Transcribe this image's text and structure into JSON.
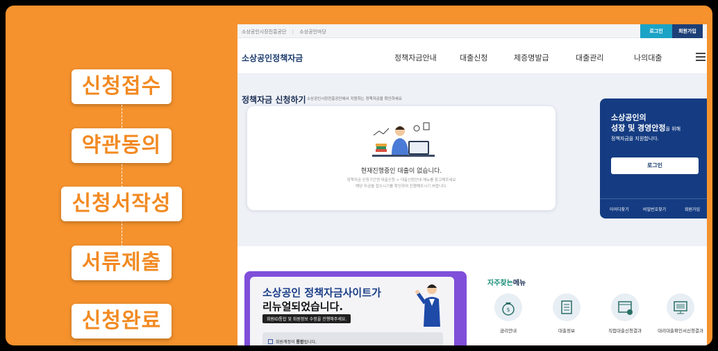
{
  "steps": [
    "신청접수",
    "약관동의",
    "신청서작성",
    "서류제출",
    "신청완료"
  ],
  "site": {
    "top_links": [
      "소상공인시장진흥공단",
      "소상공인마당"
    ],
    "login_label": "로그인",
    "join_label": "회원가입",
    "logo": "소상공인정책자금",
    "menu": [
      "정책자금안내",
      "대출신청",
      "제증명발급",
      "대출관리",
      "나의대출"
    ]
  },
  "apply": {
    "title": "정책자금 신청하기",
    "subtitle": "소상공인시장진흥공단에서 지원하는 정책자금을 확인하세요",
    "empty_message": "현재진행중인 대출이 없습니다.",
    "desc_line1": "정책자금 신청기간엔 대출신청 > 대출신청안내 메뉴를 참고해주세요",
    "desc_line2": "해당 자금별 접수시기를 확인하여 진행해주시기 바랍니다."
  },
  "panel": {
    "line1": "소상공인의",
    "line2_bold": "성장 및 경영안정",
    "line2_rest": "을 위해",
    "line3": "정책자금을 지원합니다.",
    "login_button": "로그인",
    "links": [
      "아이디찾기",
      "비밀번호찾기",
      "회원가입"
    ]
  },
  "banner": {
    "line1": "소상공인 정책자금사이트가",
    "line2": "리뉴얼되었습니다.",
    "pill": "회원ID통합 및 회원정보 수정을 진행해주세요.",
    "notice_prefix": "회원계정이 ",
    "notice_bold": "통합",
    "notice_suffix": "됩니다."
  },
  "favorites": {
    "title_accent": "자주찾는",
    "title_rest": "메뉴",
    "items": [
      "금리안내",
      "대출정보",
      "직접대출신청결과",
      "대리대출확인서신청결과"
    ]
  },
  "colors": {
    "background_orange": "#f5922d",
    "step_text": "#f28a22",
    "navy": "#153c82",
    "teal_button": "#1aa3c6",
    "purple_banner": "#7f4fd9"
  }
}
